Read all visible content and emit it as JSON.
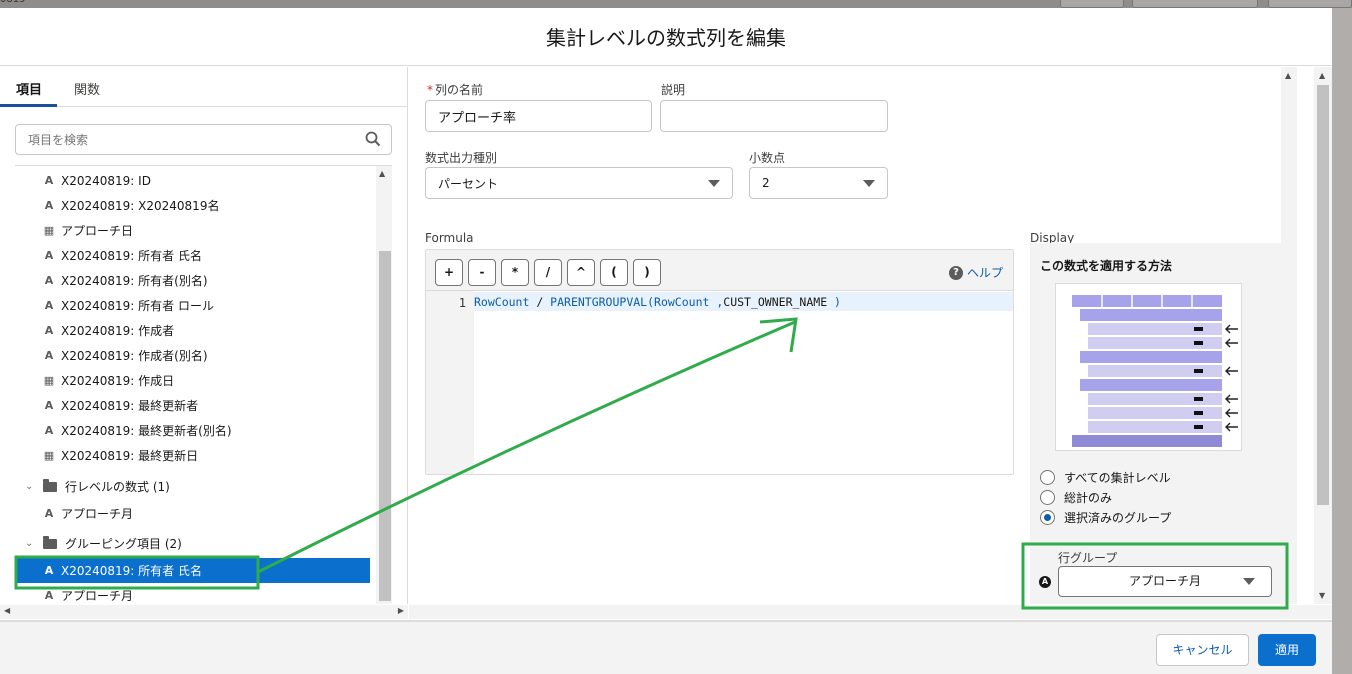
{
  "bg": {
    "tab_fragment": "0819"
  },
  "modal": {
    "title": "集計レベルの数式列を編集"
  },
  "tabs": [
    {
      "label": "項目"
    },
    {
      "label": "関数"
    }
  ],
  "search": {
    "placeholder": "項目を検索"
  },
  "fields": [
    {
      "icon": "A",
      "label": "X20240819: ID"
    },
    {
      "icon": "A",
      "label": "X20240819: X20240819名"
    },
    {
      "icon": "cal",
      "label": "アプローチ日"
    },
    {
      "icon": "A",
      "label": "X20240819: 所有者 氏名"
    },
    {
      "icon": "A",
      "label": "X20240819: 所有者(別名)"
    },
    {
      "icon": "A",
      "label": "X20240819: 所有者 ロール"
    },
    {
      "icon": "A",
      "label": "X20240819: 作成者"
    },
    {
      "icon": "A",
      "label": "X20240819: 作成者(別名)"
    },
    {
      "icon": "cal",
      "label": "X20240819: 作成日"
    },
    {
      "icon": "A",
      "label": "X20240819: 最終更新者"
    },
    {
      "icon": "A",
      "label": "X20240819: 最終更新者(別名)"
    },
    {
      "icon": "cal",
      "label": "X20240819: 最終更新日"
    }
  ],
  "groups": {
    "row_formula": {
      "label": "行レベルの数式 (1)",
      "items": [
        {
          "icon": "A",
          "label": "アプローチ月"
        }
      ]
    },
    "grouping": {
      "label": "グルーピング項目 (2)",
      "items": [
        {
          "icon": "A",
          "label": "X20240819: 所有者 氏名"
        },
        {
          "icon": "A",
          "label": "アプローチ月"
        }
      ]
    }
  },
  "form": {
    "column_name_label": "列の名前",
    "column_name_value": "アプローチ率",
    "description_label": "説明",
    "description_value": "",
    "output_type_label": "数式出力種別",
    "output_type_value": "パーセント",
    "decimal_label": "小数点",
    "decimal_value": "2"
  },
  "formula": {
    "label": "Formula",
    "operators": [
      "+",
      "-",
      "*",
      "/",
      "^",
      "(",
      ")"
    ],
    "help_label": "ヘルプ",
    "line_number": "1",
    "code_a": "RowCount",
    "code_b": " / ",
    "code_c": "PARENTGROUPVAL(RowCount ,",
    "code_d": "CUST_OWNER_NAME",
    "code_e": " )"
  },
  "display": {
    "label": "Display",
    "title": "この数式を適用する方法",
    "options": [
      {
        "label": "すべての集計レベル",
        "checked": false
      },
      {
        "label": "総計のみ",
        "checked": false
      },
      {
        "label": "選択済みのグループ",
        "checked": true
      }
    ],
    "row_group_label": "行グループ",
    "row_group_value": "アプローチ月"
  },
  "footer": {
    "cancel": "キャンセル",
    "apply": "適用"
  },
  "colors": {
    "accent": "#0b6fce",
    "annotation": "#2eab4a"
  }
}
